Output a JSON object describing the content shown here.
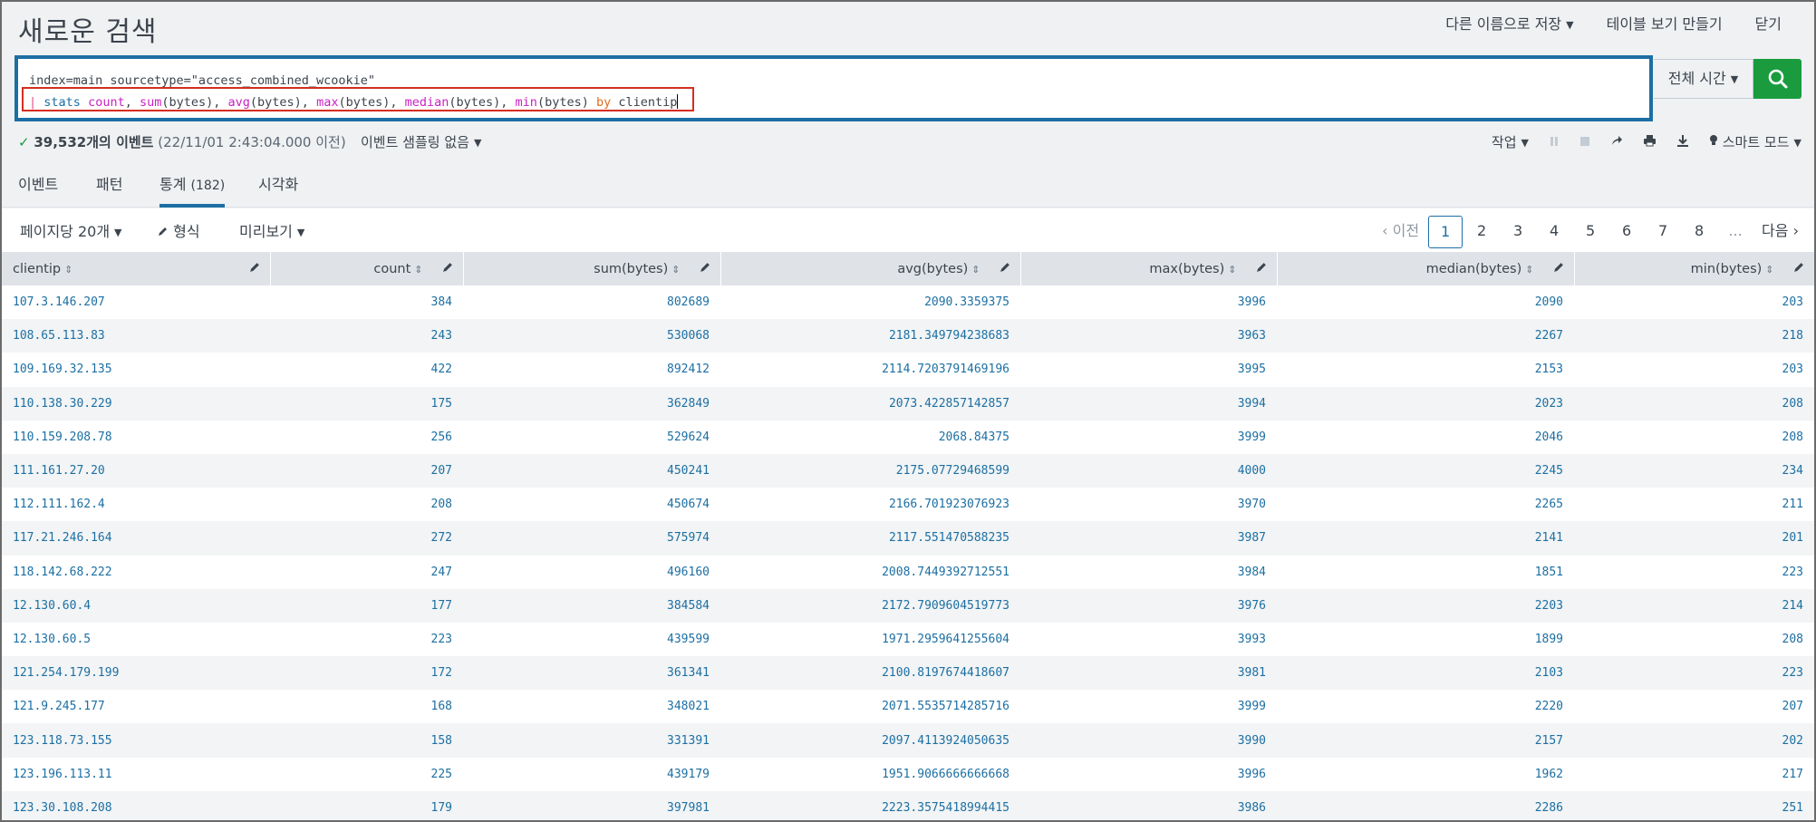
{
  "header": {
    "title": "새로운 검색",
    "save_as": "다른 이름으로 저장",
    "create_table_view": "테이블 보기 만들기",
    "close": "닫기"
  },
  "search": {
    "line1": "index=main sourcetype=\"access_combined_wcookie\"",
    "line2": {
      "pipe": "|",
      "stats": "stats",
      "count": "count",
      "sum": "sum",
      "sum_arg": "(bytes), ",
      "avg": "avg",
      "avg_arg": "(bytes), ",
      "max": "max",
      "max_arg": "(bytes), ",
      "median": "median",
      "median_arg": "(bytes), ",
      "min": "min",
      "min_arg": "(bytes) ",
      "by": "by",
      "field": "clientip"
    },
    "time_range": "전체 시간"
  },
  "status": {
    "check": "✓",
    "count": "39,532개의 이벤트",
    "time": "(22/11/01 2:43:04.000 이전)",
    "sampling": "이벤트 샘플링 없음",
    "job": "작업",
    "mode": "스마트 모드"
  },
  "tabs": {
    "events": "이벤트",
    "patterns": "패턴",
    "statistics": "통계",
    "statistics_count": "(182)",
    "visualization": "시각화"
  },
  "toolbar": {
    "per_page": "페이지당 20개",
    "format": "형식",
    "preview": "미리보기",
    "prev": "이전",
    "next": "다음",
    "pages": [
      "1",
      "2",
      "3",
      "4",
      "5",
      "6",
      "7",
      "8",
      "..."
    ]
  },
  "table": {
    "columns": [
      "clientip",
      "count",
      "sum(bytes)",
      "avg(bytes)",
      "max(bytes)",
      "median(bytes)",
      "min(bytes)"
    ],
    "rows": [
      [
        "107.3.146.207",
        "384",
        "802689",
        "2090.3359375",
        "3996",
        "2090",
        "203"
      ],
      [
        "108.65.113.83",
        "243",
        "530068",
        "2181.349794238683",
        "3963",
        "2267",
        "218"
      ],
      [
        "109.169.32.135",
        "422",
        "892412",
        "2114.7203791469196",
        "3995",
        "2153",
        "203"
      ],
      [
        "110.138.30.229",
        "175",
        "362849",
        "2073.422857142857",
        "3994",
        "2023",
        "208"
      ],
      [
        "110.159.208.78",
        "256",
        "529624",
        "2068.84375",
        "3999",
        "2046",
        "208"
      ],
      [
        "111.161.27.20",
        "207",
        "450241",
        "2175.07729468599",
        "4000",
        "2245",
        "234"
      ],
      [
        "112.111.162.4",
        "208",
        "450674",
        "2166.701923076923",
        "3970",
        "2265",
        "211"
      ],
      [
        "117.21.246.164",
        "272",
        "575974",
        "2117.551470588235",
        "3987",
        "2141",
        "201"
      ],
      [
        "118.142.68.222",
        "247",
        "496160",
        "2008.7449392712551",
        "3984",
        "1851",
        "223"
      ],
      [
        "12.130.60.4",
        "177",
        "384584",
        "2172.7909604519773",
        "3976",
        "2203",
        "214"
      ],
      [
        "12.130.60.5",
        "223",
        "439599",
        "1971.2959641255604",
        "3993",
        "1899",
        "208"
      ],
      [
        "121.254.179.199",
        "172",
        "361341",
        "2100.8197674418607",
        "3981",
        "2103",
        "223"
      ],
      [
        "121.9.245.177",
        "168",
        "348021",
        "2071.5535714285716",
        "3999",
        "2220",
        "207"
      ],
      [
        "123.118.73.155",
        "158",
        "331391",
        "2097.4113924050635",
        "3990",
        "2157",
        "202"
      ],
      [
        "123.196.113.11",
        "225",
        "439179",
        "1951.9066666666668",
        "3996",
        "1962",
        "217"
      ],
      [
        "123.30.108.208",
        "179",
        "397981",
        "2223.3575418994415",
        "3986",
        "2286",
        "251"
      ]
    ]
  }
}
